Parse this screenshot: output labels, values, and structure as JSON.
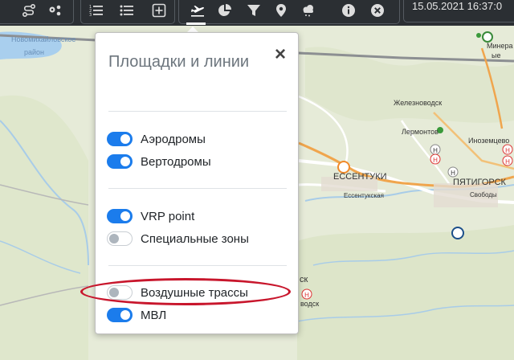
{
  "toolbar": {
    "groups": [
      {
        "buttons": [
          {
            "icon": "route-icon"
          },
          {
            "icon": "network-icon"
          }
        ]
      },
      {
        "buttons": [
          {
            "icon": "ordered-list-icon"
          },
          {
            "icon": "list-icon"
          },
          {
            "icon": "plus-square-icon"
          }
        ]
      },
      {
        "buttons": [
          {
            "icon": "airplane-takeoff-icon",
            "active": true
          },
          {
            "icon": "pie-chart-icon"
          },
          {
            "icon": "filter-icon"
          },
          {
            "icon": "map-marker-icon"
          },
          {
            "icon": "weather-cloud-icon"
          },
          {
            "icon": "info-icon"
          },
          {
            "icon": "close-circle-icon"
          }
        ]
      }
    ],
    "datetime": "15.05.2021 16:37:0"
  },
  "map": {
    "labels": {
      "reservoir_1": "Новомихайловское",
      "reservoir_2": "район",
      "essentuki": "ЕССЕНТУКИ",
      "essentukskaya": "Ессентукская",
      "pyatigorsk": "ПЯТИГОРСК",
      "svobody": "Свободы",
      "zheleznovodsk": "Железноводск",
      "lermontov": "Лермонтов",
      "inozemtsevo": "Иноземцево",
      "mineralnye": "Минера",
      "ye": "ые",
      "sk": "ск",
      "vodsk": "водск"
    },
    "colors": {
      "land": "#e7ecd9",
      "river": "#9ec6e6",
      "road_orange": "#f0a54d",
      "road_white": "#ffffff"
    }
  },
  "popup": {
    "title": "Площадки и линии",
    "close": "×",
    "items": [
      {
        "label": "Аэродромы",
        "on": true
      },
      {
        "label": "Вертодромы",
        "on": true
      },
      {
        "label": "VRP point",
        "on": true
      },
      {
        "label": "Специальные зоны",
        "on": false
      },
      {
        "label": "Воздушные трассы",
        "on": false
      },
      {
        "label": "МВЛ",
        "on": true
      }
    ],
    "accent": "#1b7cec",
    "highlight_color": "#c8162c"
  }
}
